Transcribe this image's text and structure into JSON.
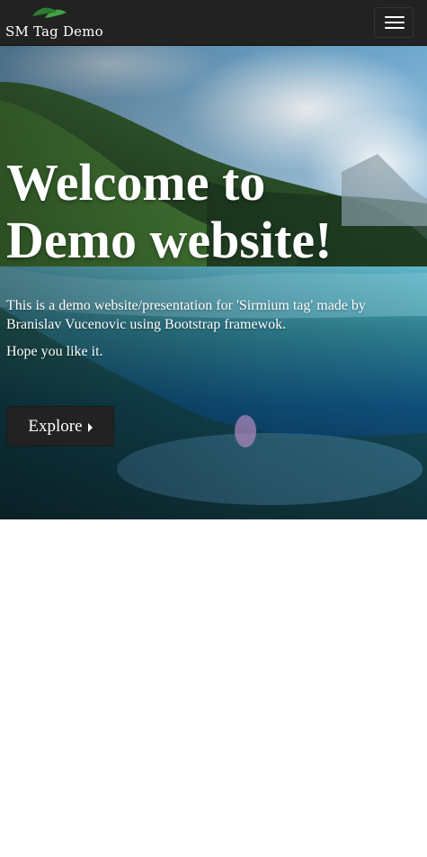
{
  "navbar": {
    "brand": "SM Tag Demo",
    "logo_icon": "leaf-logo-icon",
    "toggle_icon": "hamburger-menu-icon"
  },
  "hero": {
    "title": "Welcome to Demo website!",
    "text": "This is a demo website/presentation for 'Sirmium tag' made by Branislav Vucenovic using Bootstrap framewok.",
    "text2": "Hope you like it.",
    "button_label": "Explore",
    "button_icon": "caret-right-icon"
  },
  "colors": {
    "navbar_bg": "#222222",
    "button_bg": "#222222",
    "text": "#ffffff",
    "page_bg": "#ffffff"
  }
}
